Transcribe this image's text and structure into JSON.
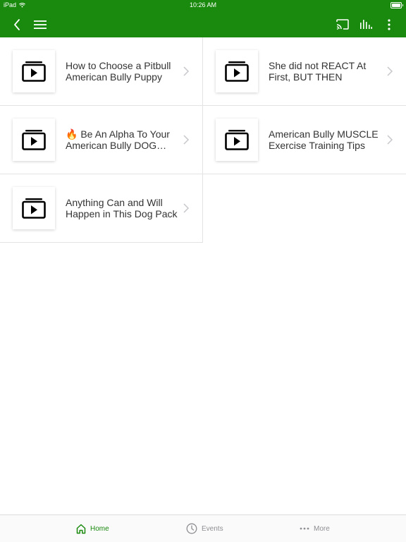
{
  "status_bar": {
    "device": "iPad",
    "time": "10:26 AM"
  },
  "toolbar": {
    "back_icon": "chevron-left-icon",
    "menu_icon": "hamburger-menu-icon",
    "cast_icon": "cast-icon",
    "audio_icon": "equalizer-icon",
    "more_icon": "vertical-dots-icon"
  },
  "videos": [
    {
      "title": "How to Choose a Pitbull American Bully Puppy",
      "icon": "video-play-icon"
    },
    {
      "title": "She did not REACT At First, BUT THEN",
      "icon": "video-play-icon"
    },
    {
      "title": "🔥 Be An Alpha To Your American Bully DOG PA...",
      "icon": "video-play-icon"
    },
    {
      "title": "American Bully MUSCLE Exercise Training Tips",
      "icon": "video-play-icon"
    },
    {
      "title": "Anything Can and Will Happen in This Dog Pack",
      "icon": "video-play-icon"
    }
  ],
  "tabbar": {
    "home_label": "Home",
    "events_label": "Events",
    "more_label": "More"
  },
  "colors": {
    "brand_green": "#1a8a0f",
    "inactive_gray": "#8e8e93"
  }
}
